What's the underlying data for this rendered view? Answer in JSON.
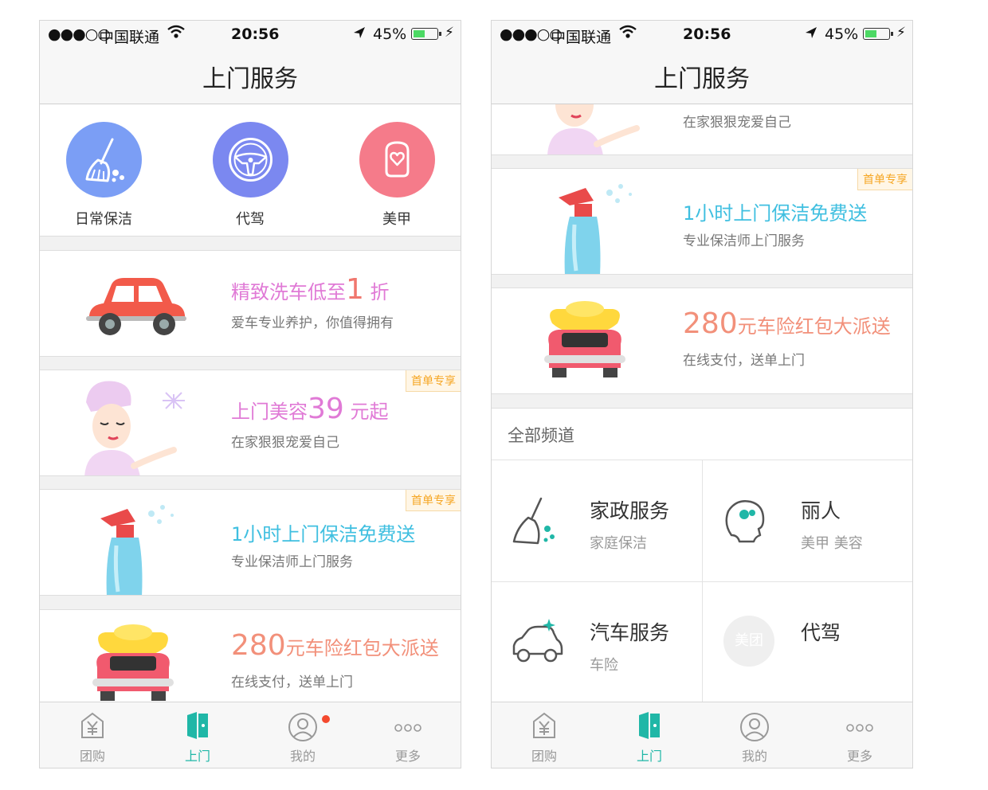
{
  "status_bar": {
    "signal": "●●●○○",
    "carrier": "中国联通",
    "time": "20:56",
    "battery": "45%",
    "battery_level": 0.45
  },
  "navbar": {
    "title": "上门服务"
  },
  "categories": [
    {
      "label": "日常保洁",
      "icon": "broom-icon",
      "color": "#7b9ef5"
    },
    {
      "label": "代驾",
      "icon": "steering-wheel-icon",
      "color": "#7b88f0"
    },
    {
      "label": "美甲",
      "icon": "nail-icon",
      "color": "#f57b8a"
    }
  ],
  "banners": {
    "car_wash": {
      "title_pre": "精致洗车低至",
      "title_num": "1",
      "title_post": "折",
      "subtitle": "爱车专业养护，你值得拥有",
      "color": "#e07ad6"
    },
    "beauty": {
      "title_pre": "上门美容",
      "title_num": "39",
      "title_post": "元起",
      "subtitle": "在家狠狠宠爱自己",
      "tag": "首单专享",
      "color": "#e07ad6"
    },
    "cleaning": {
      "title": "1小时上门保洁免费送",
      "subtitle": "专业保洁师上门服务",
      "tag": "首单专享",
      "color": "#3fbfe0"
    },
    "insurance": {
      "title_num": "280",
      "title_post": "元车险红包大派送",
      "subtitle": "在线支付，送单上门",
      "color": "#f2907a"
    }
  },
  "channels": {
    "header": "全部频道",
    "items": [
      {
        "name": "家政服务",
        "sub": "家庭保洁",
        "icon": "broom-icon"
      },
      {
        "name": "丽人",
        "sub": "美甲 美容",
        "icon": "head-icon"
      },
      {
        "name": "汽车服务",
        "sub": "车险",
        "icon": "car-icon"
      },
      {
        "name": "代驾",
        "sub": "",
        "icon": "meituan-placeholder-icon",
        "placeholder": "美团"
      }
    ]
  },
  "tabbar": [
    {
      "label": "团购",
      "icon": "yuan-tag-icon"
    },
    {
      "label": "上门",
      "icon": "door-icon",
      "active": true
    },
    {
      "label": "我的",
      "icon": "user-icon"
    },
    {
      "label": "更多",
      "icon": "more-icon"
    }
  ],
  "colors": {
    "accent": "#20b7a7",
    "tag_bg": "#fff6e6",
    "tag_text": "#f6a623",
    "badge": "#f4492e"
  }
}
